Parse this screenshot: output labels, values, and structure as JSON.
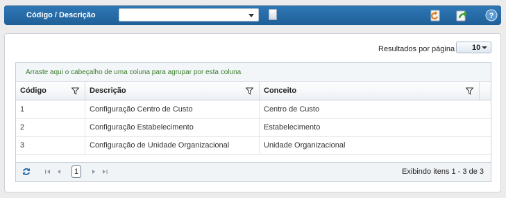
{
  "toolbar": {
    "label": "Código / Descrição",
    "select_value": "",
    "icons": [
      "undo-icon",
      "export-icon",
      "help-icon"
    ]
  },
  "results_per_page": {
    "label": "Resultados por página",
    "value": "10"
  },
  "grid": {
    "grouping_hint": "Arraste aqui o cabeçalho de uma coluna para agrupar por esta coluna",
    "columns": [
      "Código",
      "Descrição",
      "Conceito"
    ],
    "rows": [
      [
        "1",
        "Configuração Centro de Custo",
        "Centro de Custo"
      ],
      [
        "2",
        "Configuração Estabelecimento",
        "Estabelecimento"
      ],
      [
        "3",
        "Configuração de Unidade Organizacional",
        "Unidade Organizacional"
      ]
    ]
  },
  "pager": {
    "current_page": "1",
    "info": "Exibindo itens 1 - 3 de 3"
  },
  "colors": {
    "toolbar": "#2a6ead",
    "accent_green": "#3a7a2a"
  }
}
